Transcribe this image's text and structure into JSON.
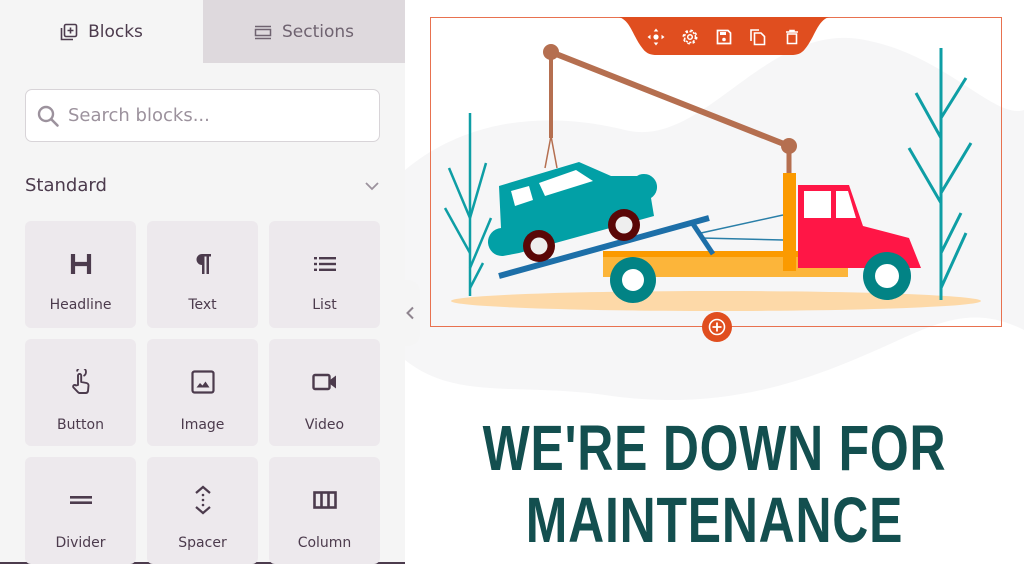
{
  "sidebar": {
    "tabs": [
      {
        "label": "Blocks",
        "icon": "add-block-icon",
        "active": true
      },
      {
        "label": "Sections",
        "icon": "sections-icon",
        "active": false
      }
    ],
    "search": {
      "placeholder": "Search blocks...",
      "value": ""
    },
    "section": {
      "title": "Standard",
      "expanded": true
    },
    "blocks": [
      {
        "label": "Headline",
        "icon": "headline-icon"
      },
      {
        "label": "Text",
        "icon": "paragraph-icon"
      },
      {
        "label": "List",
        "icon": "list-icon"
      },
      {
        "label": "Button",
        "icon": "pointer-hand-icon"
      },
      {
        "label": "Image",
        "icon": "image-icon"
      },
      {
        "label": "Video",
        "icon": "video-camera-icon"
      },
      {
        "label": "Divider",
        "icon": "divider-icon"
      },
      {
        "label": "Spacer",
        "icon": "spacer-icon"
      },
      {
        "label": "Column",
        "icon": "columns-icon"
      }
    ]
  },
  "canvas": {
    "toolbar": [
      "move-icon",
      "gear-icon",
      "save-icon",
      "duplicate-icon",
      "trash-icon"
    ],
    "headline": "WE'RE DOWN FOR MAINTENANCE",
    "colors": {
      "accent": "#e04e1f",
      "headline": "#134f4f",
      "frame": "#e8714f"
    }
  }
}
